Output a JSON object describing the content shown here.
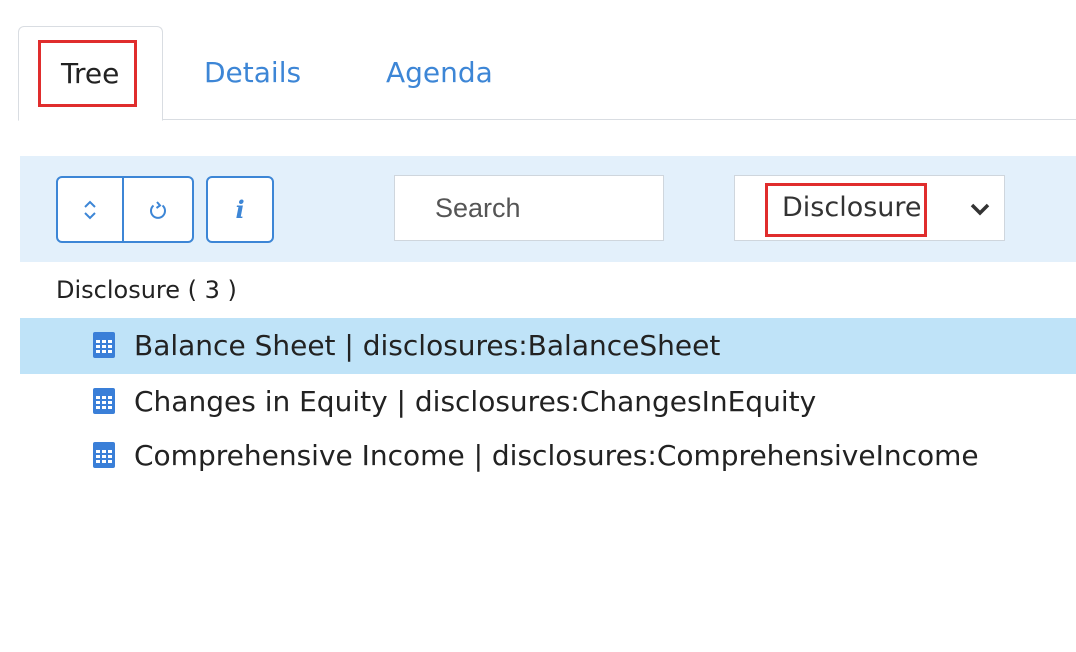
{
  "tabs": {
    "tree": "Tree",
    "details": "Details",
    "agenda": "Agenda"
  },
  "toolbar": {
    "expand_icon": "chevron-up-down-icon",
    "refresh_icon": "refresh-icon",
    "info_label": "i",
    "search_placeholder": "Search",
    "filter_value": "Disclosure"
  },
  "tree": {
    "group_label": "Disclosure ( 3 )",
    "items": [
      {
        "label": "Balance Sheet | disclosures:BalanceSheet",
        "icon": "table-icon",
        "selected": true
      },
      {
        "label": "Changes in Equity | disclosures:ChangesInEquity",
        "icon": "table-icon",
        "selected": false
      },
      {
        "label": "Comprehensive Income | disclosures:ComprehensiveIncome",
        "icon": "table-icon",
        "selected": false
      }
    ]
  },
  "colors": {
    "accent": "#3d86d6",
    "toolbar_bg": "#e3f0fb",
    "selected_row": "#bfe3f8",
    "highlight": "#e02d2d",
    "icon": "#3a7fd8"
  }
}
